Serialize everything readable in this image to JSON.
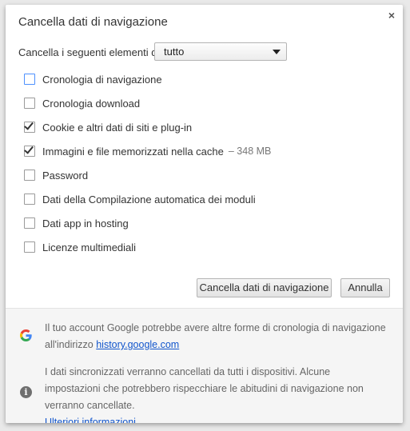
{
  "dialog": {
    "title": "Cancella dati di navigazione",
    "close_symbol": "×"
  },
  "time_range": {
    "label": "Cancella i seguenti elementi da:",
    "selected": "tutto"
  },
  "options": [
    {
      "label": "Cronologia di navigazione",
      "checked": false,
      "focused": true
    },
    {
      "label": "Cronologia download",
      "checked": false
    },
    {
      "label": "Cookie e altri dati di siti e plug-in",
      "checked": true
    },
    {
      "label": "Immagini e file memorizzati nella cache",
      "checked": true,
      "extra": "–  348 MB"
    },
    {
      "label": "Password",
      "checked": false
    },
    {
      "label": "Dati della Compilazione automatica dei moduli",
      "checked": false
    },
    {
      "label": "Dati app in hosting",
      "checked": false
    },
    {
      "label": "Licenze multimediali",
      "checked": false
    }
  ],
  "buttons": {
    "clear": "Cancella dati di navigazione",
    "cancel": "Annulla"
  },
  "footer": {
    "google_text": "Il tuo account Google potrebbe avere altre forme di cronologia di navigazione all'indirizzo",
    "google_link": "history.google.com",
    "sync_text": "I dati sincronizzati verranno cancellati da tutti i dispositivi. Alcune impostazioni che potrebbero rispecchiare le abitudini di navigazione non verranno cancellate.",
    "more_link": "Ulteriori informazioni",
    "icons": [
      "google-g-icon",
      "info-icon"
    ]
  },
  "colors": {
    "link": "#1155cc",
    "focus_border": "#4d90fe",
    "google_blue": "#4285f4",
    "google_red": "#ea4335",
    "google_yellow": "#fbbc05",
    "google_green": "#34a853"
  }
}
